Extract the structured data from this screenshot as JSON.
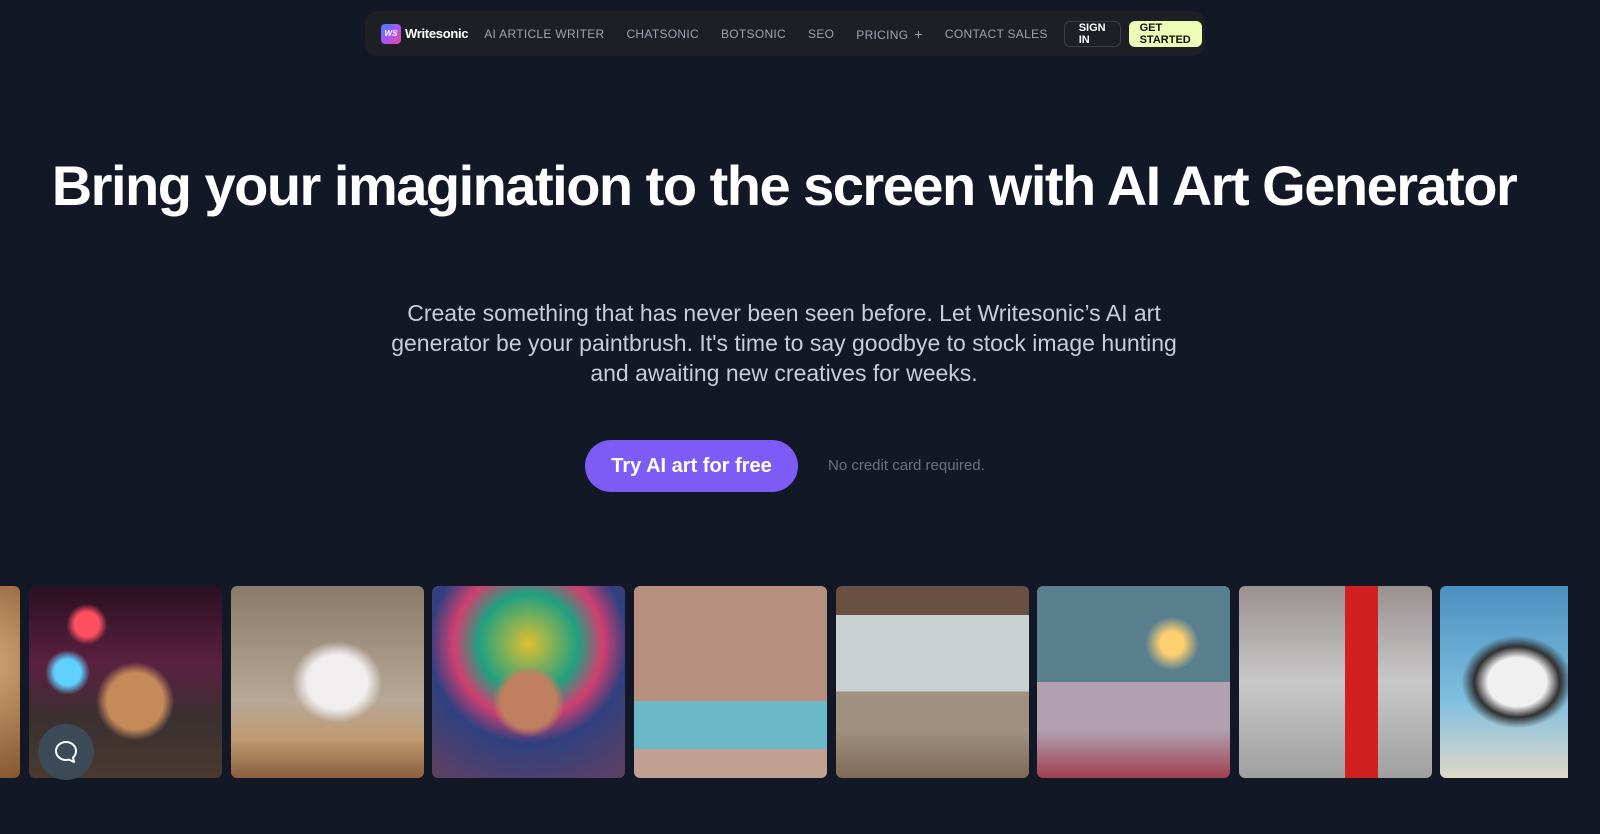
{
  "nav": {
    "brand": "Writesonic",
    "brand_mark": "WS",
    "links": [
      "AI ARTICLE WRITER",
      "CHATSONIC",
      "BOTSONIC",
      "SEO",
      "PRICING",
      "CONTACT SALES"
    ],
    "sign_in": "SIGN IN",
    "get_started": "GET STARTED"
  },
  "hero": {
    "title": "Bring your imagination to the screen with AI Art Generator",
    "subtitle": "Create something that has never been seen before. Let Writesonic’s AI art generator be your paintbrush. It's time to say goodbye to stock image hunting and awaiting new creatives for weeks.",
    "cta": "Try AI art for free",
    "note": "No credit card required."
  },
  "gallery": [
    "cat",
    "rabbit-on-bicycle",
    "unicorn-figurine",
    "aztec-woman-portrait",
    "living-room-blue-sofa",
    "living-room-windows",
    "bedroom-lamps",
    "red-phone-booth",
    "husky-on-beach"
  ],
  "colors": {
    "background": "#121826",
    "accent": "#7c5cf5",
    "get_started_bg": "#ecfcb6"
  },
  "icons": {
    "chat": "chat-bubble-icon",
    "pricing": "plus-icon"
  }
}
